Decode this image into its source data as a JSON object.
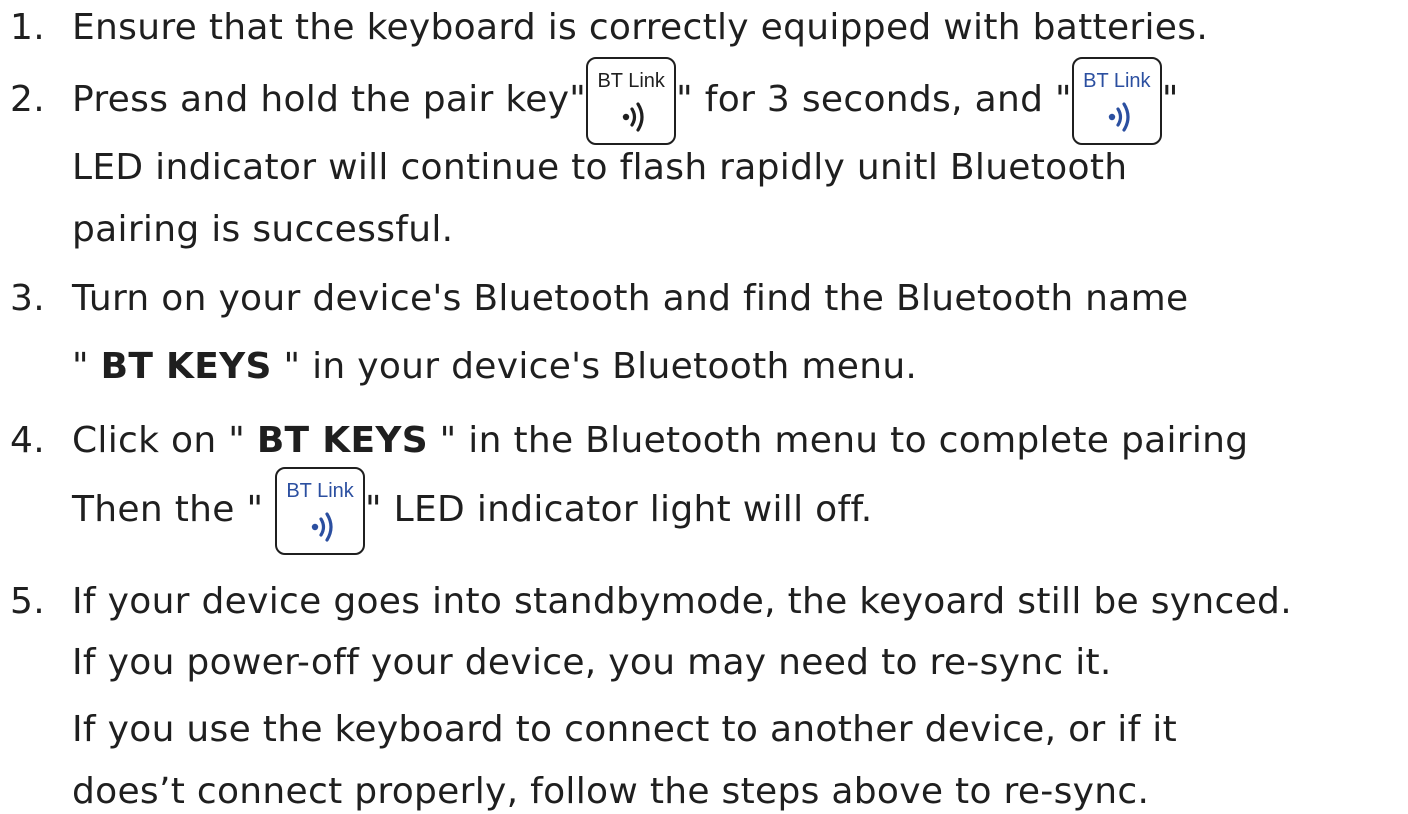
{
  "steps": [
    {
      "number": "1.",
      "lines": [
        {
          "text": "Ensure that the keyboard is correctly equipped with batteries."
        }
      ]
    },
    {
      "number": "2.",
      "line1": {
        "before": "Press and hold the pair key\"",
        "middle": "\" for 3 seconds, and \"",
        "after": "\""
      },
      "line2": "LED indicator will continue to flash rapidly unitl Bluetooth",
      "line3": "pairing is successful."
    },
    {
      "number": "3.",
      "line1": "Turn on your device's Bluetooth and find the Bluetooth name",
      "line2": {
        "before": " \" ",
        "bold": "BT KEYS",
        "after": " \" in your device's Bluetooth menu."
      }
    },
    {
      "number": "4.",
      "line1": {
        "before": "Click on \" ",
        "bold": "BT KEYS",
        "after": " \" in the Bluetooth menu to complete pairing"
      },
      "line2": {
        "before": "Then the \" ",
        "after": "\" LED indicator light will off."
      }
    },
    {
      "number": "5.",
      "lines": [
        {
          "text": "If your device goes into standbymode, the keyoard still be synced."
        },
        {
          "text": "If you power-off your device, you may need to re-sync it."
        },
        {
          "text": "If you use the keyboard to connect to another device, or if it"
        },
        {
          "text": "does’t connect properly, follow the steps above to re-sync."
        }
      ]
    }
  ],
  "key_icon": {
    "label": "BT Link",
    "icon": "bluetooth-signal-icon",
    "black_color": "#1f1f1f",
    "blue_color": "#2b4fa0"
  }
}
